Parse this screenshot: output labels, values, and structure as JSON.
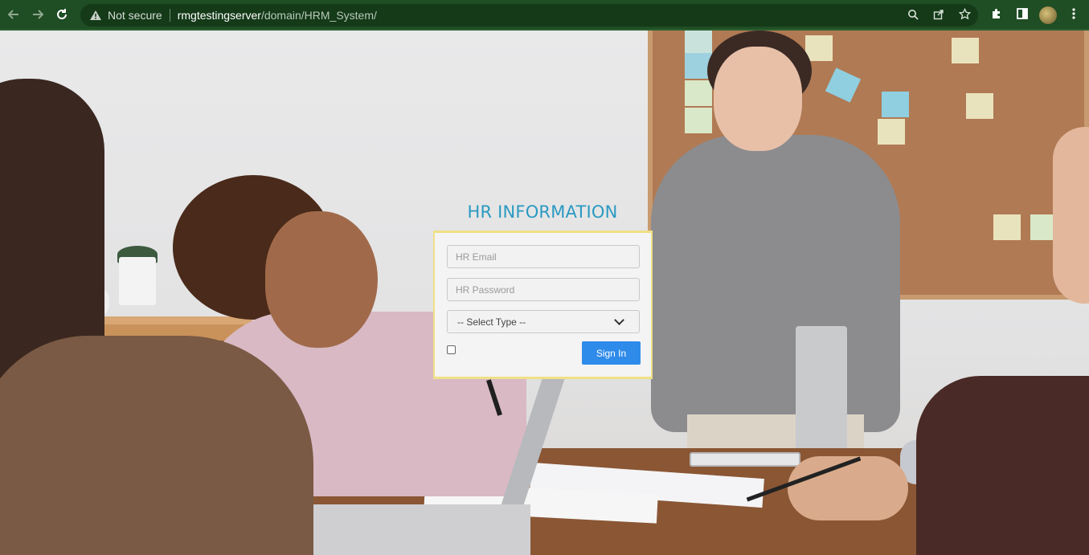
{
  "browser": {
    "back_icon": "arrow-left-icon",
    "forward_icon": "arrow-right-icon",
    "reload_icon": "reload-icon",
    "security_label": "Not secure",
    "url_host": "rmgtestingserver",
    "url_path": "/domain/HRM_System/",
    "actions": [
      "zoom-icon",
      "share-icon",
      "star-icon"
    ],
    "extras": [
      "puzzle-icon",
      "side-panel-icon",
      "profile-avatar",
      "kebab-menu-icon"
    ]
  },
  "login": {
    "title": "HR INFORMATION",
    "email_placeholder": "HR Email",
    "password_placeholder": "HR Password",
    "select_value": "-- Select Type --",
    "signin_label": "Sign In"
  },
  "colors": {
    "title": "#2a9ac0",
    "signin_button": "#2f8bea",
    "box_border": "#efe086",
    "chrome": "#1f4d24"
  }
}
